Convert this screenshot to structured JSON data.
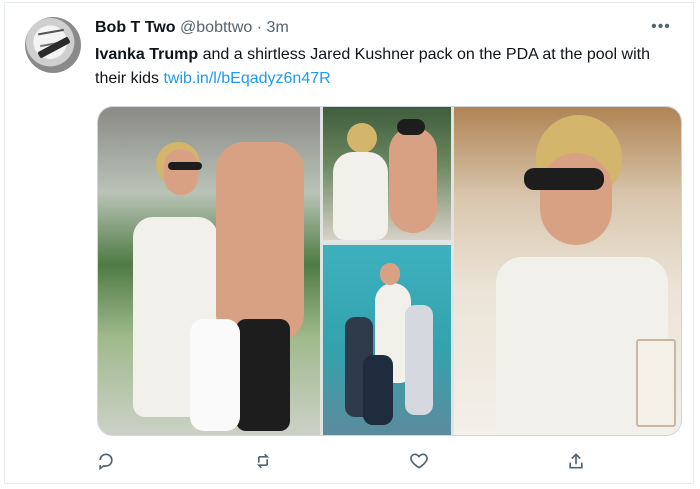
{
  "tweet": {
    "author_name": "Bob T Two",
    "handle": "@bobttwo",
    "separator": "·",
    "time": "3m",
    "text_bold": "Ivanka Trump",
    "text_rest": " and a shirtless Jared Kushner pack on the PDA at the pool with their kids ",
    "link": "twib.in/l/bEqadyz6n47R"
  },
  "icons": {
    "more": "more-icon",
    "reply": "reply-icon",
    "retweet": "retweet-icon",
    "like": "like-icon",
    "share": "share-icon"
  },
  "colors": {
    "link": "#1d9bf0",
    "secondary_text": "#536471",
    "border": "#e6ecf0"
  }
}
